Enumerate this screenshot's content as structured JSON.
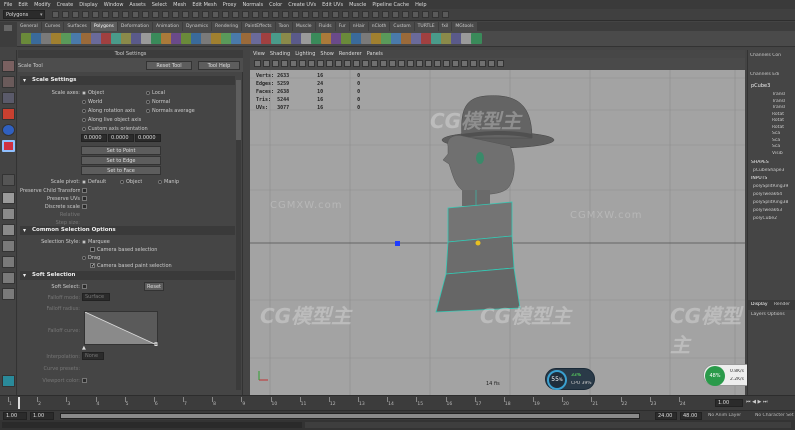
{
  "menubar": {
    "items": [
      "File",
      "Edit",
      "Modify",
      "Create",
      "Display",
      "Window",
      "Assets",
      "Select",
      "Mesh",
      "Edit Mesh",
      "Proxy",
      "Normals",
      "Color",
      "Create UVs",
      "Edit UVs",
      "Muscle",
      "Pipeline Cache",
      "Help"
    ]
  },
  "statusline": {
    "mode": "Polygons"
  },
  "shelf": {
    "tabs": [
      "General",
      "Curves",
      "Surfaces",
      "Polygons",
      "Deformation",
      "Animation",
      "Dynamics",
      "Rendering",
      "PaintEffects",
      "Toon",
      "Muscle",
      "Fluids",
      "Fur",
      "nHair",
      "nCloth",
      "Custom",
      "TURTLE",
      "fxil",
      "MGtools"
    ],
    "active_tab": "Polygons"
  },
  "tool_settings": {
    "panel_title": "Tool Settings",
    "tool_name": "Scale Tool",
    "reset_label": "Reset Tool",
    "help_label": "Tool Help",
    "scale_settings": {
      "title": "Scale Settings",
      "scale_axes_label": "Scale axes:",
      "axes_options": [
        "Object",
        "Local",
        "World",
        "Normal",
        "Along rotation axis",
        "Normals average",
        "Along live object axis"
      ],
      "custom_axis_label": "Custom axis orientation",
      "vals": [
        "0.0000",
        "0.0000",
        "0.0000"
      ],
      "set_point": "Set to Point",
      "set_edge": "Set to Edge",
      "set_face": "Set to Face",
      "pivot_label": "Scale pivot:",
      "pivot_options": [
        "Default",
        "Object",
        "Manip"
      ],
      "preserve_child": "Preserve Child Transform",
      "preserve_uvs": "Preserve UVs",
      "discrete_scale": "Discrete scale",
      "relative": "Relative",
      "step_size": "Step size:"
    },
    "common_selection": {
      "title": "Common Selection Options",
      "style_label": "Selection Style:",
      "marquee": "Marquee",
      "camera_sel": "Camera based selection",
      "drag": "Drag",
      "camera_paint": "Camera based paint selection"
    },
    "soft_selection": {
      "title": "Soft Selection",
      "soft_select_label": "Soft Select:",
      "reset_label": "Reset",
      "falloff_mode_label": "Falloff mode:",
      "falloff_mode": "Surface",
      "falloff_radius_label": "Falloff radius:",
      "falloff_curve_label": "Falloff curve:",
      "interpolation_label": "Interpolation:",
      "interpolation": "None",
      "curve_presets_label": "Curve presets:",
      "viewport_color_label": "Viewport color:"
    }
  },
  "viewport": {
    "menu": [
      "View",
      "Shading",
      "Lighting",
      "Show",
      "Renderer",
      "Panels"
    ],
    "hud": [
      {
        "label": "Verts:",
        "a": "2633",
        "b": "16",
        "c": "0"
      },
      {
        "label": "Edges:",
        "a": "5259",
        "b": "24",
        "c": "0"
      },
      {
        "label": "Faces:",
        "a": "2638",
        "b": "10",
        "c": "0"
      },
      {
        "label": "Tris:",
        "a": "5244",
        "b": "16",
        "c": "0"
      },
      {
        "label": "UVs:",
        "a": "3077",
        "b": "16",
        "c": "0"
      }
    ],
    "frame_rate": "14 fis"
  },
  "channel_box": {
    "title": "Channels Con",
    "menu": [
      "Channels",
      "Edi"
    ],
    "object": "pCube3",
    "attrs": [
      "Transl",
      "Transl",
      "Transl",
      "Rotat",
      "Rotat",
      "Rotat",
      "Sca",
      "Sca",
      "Sca",
      "Visib"
    ],
    "shapes_label": "SHAPES",
    "shape": "pCubeShape3",
    "inputs_label": "INPUTS",
    "inputs": [
      "polySplitRing39",
      "polyTweak64",
      "polySplitRing38",
      "polyTweak63",
      "polyCube2"
    ],
    "tabs": [
      "Display",
      "Render"
    ],
    "sub_tabs": [
      "Layers",
      "Options"
    ]
  },
  "perf_widget": {
    "fps": "55",
    "fps_unit": "%",
    "line1": "33%",
    "line2": "CPU 39%"
  },
  "net_widget": {
    "value": "48%",
    "up": "0.8K/s",
    "down": "2.2K/s"
  },
  "timeline": {
    "ticks": [
      "1",
      "2",
      "3",
      "4",
      "5",
      "6",
      "7",
      "8",
      "9",
      "10",
      "11",
      "12",
      "13",
      "14",
      "15",
      "16",
      "17",
      "18",
      "19",
      "20",
      "21",
      "22",
      "23",
      "24"
    ],
    "current": "1.00",
    "start": "1.00",
    "start2": "1.00",
    "end": "24.00",
    "end2": "48.00",
    "anim_layer": "No Anim Layer",
    "char_set": "No Character Set"
  },
  "colors": {
    "accent_teal": "#33c9b4",
    "selection_blue": "#1e3cff",
    "pivot_yellow": "#e8c020",
    "viewport_bg": "#a3a3a3"
  }
}
